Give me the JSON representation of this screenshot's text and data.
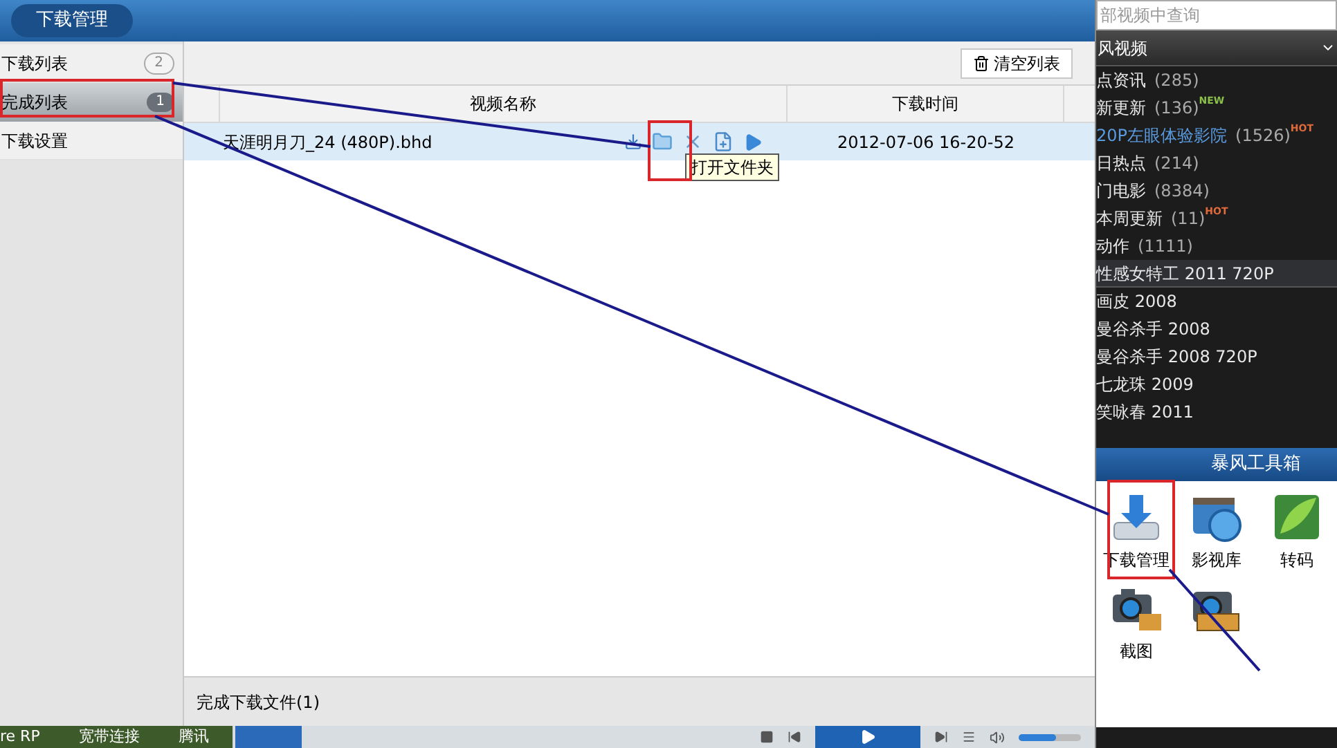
{
  "window": {
    "title": "下载管理"
  },
  "sidebar": {
    "items": [
      {
        "label": "下载列表",
        "count": "2",
        "selected": false
      },
      {
        "label": "完成列表",
        "count": "1",
        "selected": true
      },
      {
        "label": "下载设置",
        "selected": false
      }
    ]
  },
  "toolbar": {
    "clear_button": "清空列表"
  },
  "table": {
    "columns": [
      "视频名称",
      "下载时间"
    ],
    "rows": [
      {
        "name": "天涯明月刀_24 (480P).bhd",
        "time": "2012-07-06 16-20-52",
        "selected": true
      }
    ]
  },
  "tooltip": "打开文件夹",
  "status_bar": "完成下载文件(1)",
  "taskbar": {
    "items": [
      "re RP",
      "宽带连接",
      "腾讯"
    ],
    "volume": {
      "level": 0.6
    }
  },
  "side_panel": {
    "search": {
      "placeholder": "部视频中查询"
    },
    "source": "风视频",
    "items": [
      {
        "label": "点资讯",
        "count": "(285)",
        "kind": "category",
        "highlighted": false
      },
      {
        "label": "新更新",
        "count": "(136)",
        "kind": "category",
        "badge": "NEW",
        "highlighted": false
      },
      {
        "label": "20P左眼体验影院",
        "count": "(1526)",
        "kind": "category",
        "badge": "HOT",
        "highlighted": true
      },
      {
        "label": "日热点",
        "count": "(214)",
        "kind": "category",
        "highlighted": false
      },
      {
        "label": "门电影",
        "count": "(8384)",
        "kind": "category",
        "highlighted": false
      },
      {
        "label": "本周更新",
        "count": "(11)",
        "kind": "category",
        "badge": "HOT",
        "highlighted": false
      },
      {
        "label": "动作",
        "count": "(1111)",
        "kind": "category",
        "highlighted": false
      },
      {
        "label": "性感女特工 2011 720P",
        "kind": "group",
        "highlighted": false
      },
      {
        "label": "画皮 2008",
        "kind": "video",
        "highlighted": false
      },
      {
        "label": "曼谷杀手 2008",
        "kind": "video",
        "highlighted": false
      },
      {
        "label": "曼谷杀手 2008 720P",
        "kind": "video",
        "highlighted": false
      },
      {
        "label": "七龙珠 2009",
        "kind": "video",
        "highlighted": false
      },
      {
        "label": "笑咏春 2011",
        "kind": "video",
        "highlighted": false
      }
    ],
    "toolbox": {
      "title": "暴风工具箱",
      "tools": [
        {
          "label": "下载管理",
          "kind": "download"
        },
        {
          "label": "影视库",
          "kind": "library"
        },
        {
          "label": "转码",
          "kind": "convert"
        },
        {
          "label": "截图",
          "kind": "camera"
        },
        {
          "kind": "camera-film"
        }
      ]
    }
  }
}
